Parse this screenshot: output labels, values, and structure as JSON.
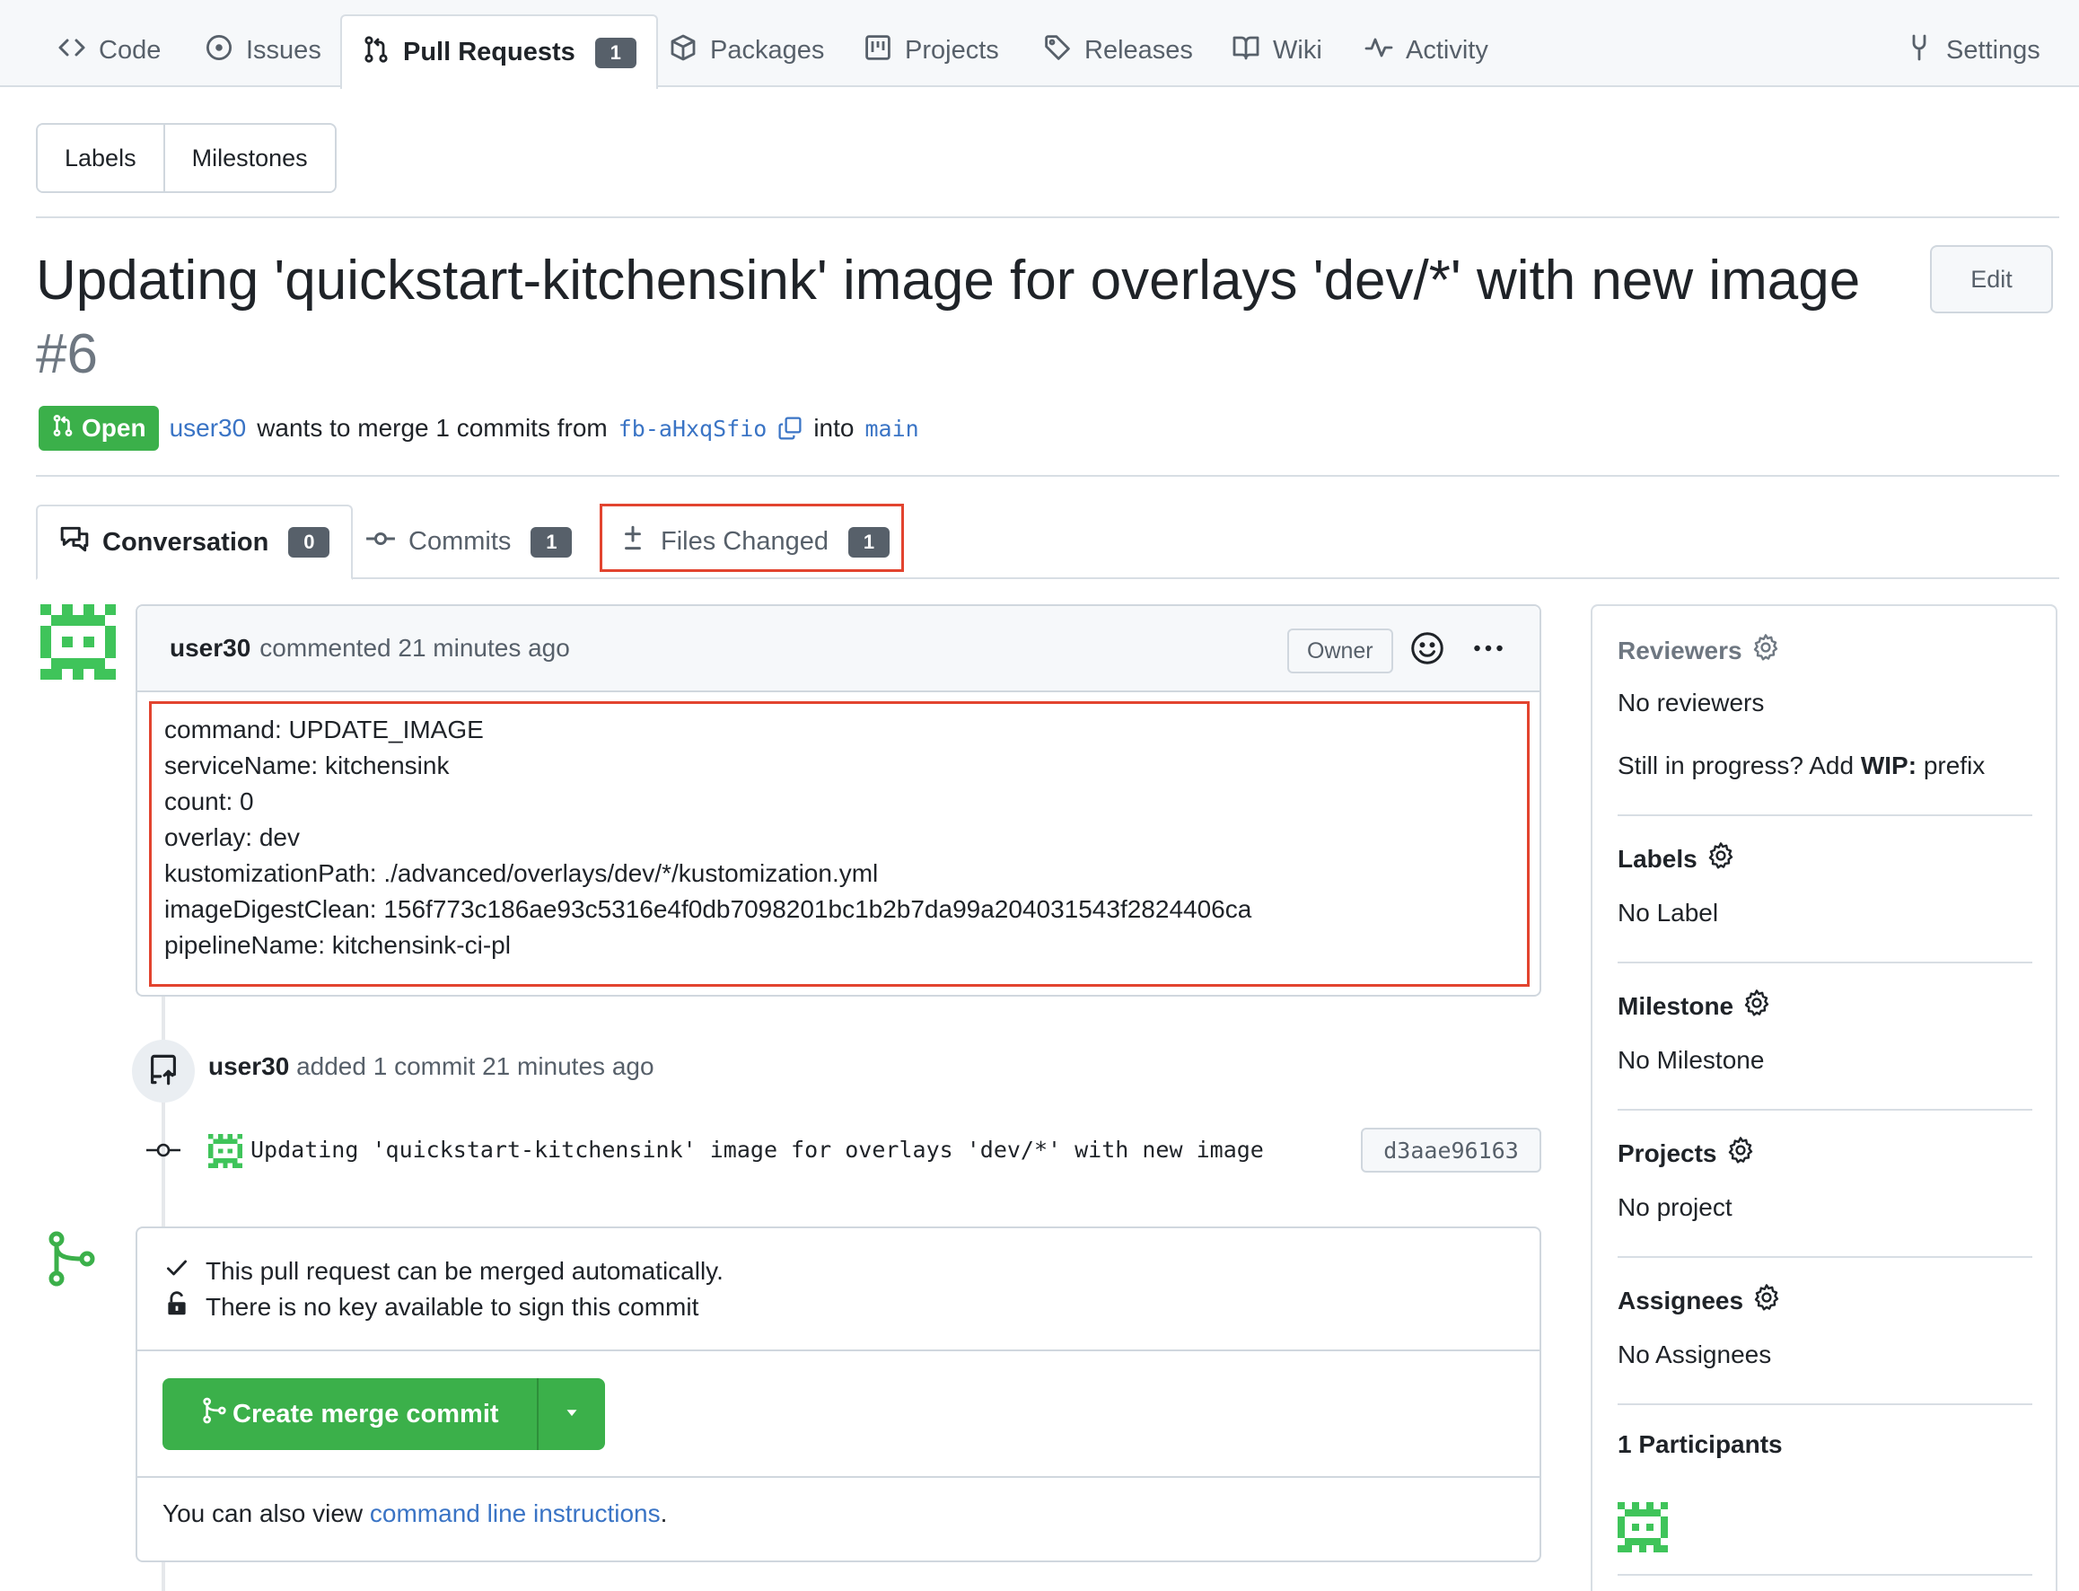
{
  "nav": {
    "code": "Code",
    "issues": "Issues",
    "pull_requests": "Pull Requests",
    "pull_requests_count": "1",
    "packages": "Packages",
    "projects": "Projects",
    "releases": "Releases",
    "wiki": "Wiki",
    "activity": "Activity",
    "settings": "Settings"
  },
  "filters": {
    "labels": "Labels",
    "milestones": "Milestones"
  },
  "pr": {
    "title": "Updating 'quickstart-kitchensink' image for overlays 'dev/*' with new image",
    "number": "#6",
    "edit": "Edit",
    "state": "Open",
    "author": "user30",
    "merge_text": "wants to merge 1 commits from",
    "head_branch": "fb-aHxqSfio",
    "into": "into",
    "base_branch": "main"
  },
  "tabs": {
    "conversation": "Conversation",
    "conversation_count": "0",
    "commits": "Commits",
    "commits_count": "1",
    "files_changed": "Files Changed",
    "files_changed_count": "1"
  },
  "comment": {
    "author": "user30",
    "meta": "commented 21 minutes ago",
    "role": "Owner",
    "lines": [
      "command: UPDATE_IMAGE",
      "serviceName: kitchensink",
      "count: 0",
      "overlay: dev",
      "kustomizationPath: ./advanced/overlays/dev/*/kustomization.yml",
      "imageDigestClean: 156f773c186ae93c5316e4f0db7098201bc1b2b7da99a204031543f2824406ca",
      "pipelineName: kitchensink-ci-pl"
    ]
  },
  "event": {
    "author": "user30",
    "text": "added 1 commit 21 minutes ago"
  },
  "commit": {
    "message": "Updating 'quickstart-kitchensink' image for overlays 'dev/*' with new image",
    "sha": "d3aae96163"
  },
  "merge": {
    "status": "This pull request can be merged automatically.",
    "signing": "There is no key available to sign this commit",
    "button": "Create merge commit",
    "footer_prefix": "You can also view",
    "footer_link": "command line instructions",
    "footer_suffix": "."
  },
  "sidebar": {
    "reviewers_title": "Reviewers",
    "reviewers_value": "No reviewers",
    "wip_prefix": "Still in progress? Add",
    "wip_bold": "WIP:",
    "wip_suffix": "prefix",
    "labels_title": "Labels",
    "labels_value": "No Label",
    "milestone_title": "Milestone",
    "milestone_value": "No Milestone",
    "projects_title": "Projects",
    "projects_value": "No project",
    "assignees_title": "Assignees",
    "assignees_value": "No Assignees",
    "participants_title": "1 Participants"
  },
  "colors": {
    "open_green": "#3bb04a",
    "link_blue": "#3a74c5",
    "highlight_red": "#e2442f",
    "avatar_green": "#3fc45a"
  },
  "icons": [
    "code-icon",
    "issue-icon",
    "pull-request-icon",
    "package-icon",
    "project-icon",
    "tag-icon",
    "book-icon",
    "pulse-icon",
    "settings-icon",
    "copy-icon",
    "conversation-icon",
    "commit-icon",
    "diff-icon",
    "smiley-icon",
    "kebab-icon",
    "push-icon",
    "merge-icon",
    "check-icon",
    "unlock-icon",
    "caret-down-icon",
    "gear-icon",
    "avatar-identicon"
  ]
}
